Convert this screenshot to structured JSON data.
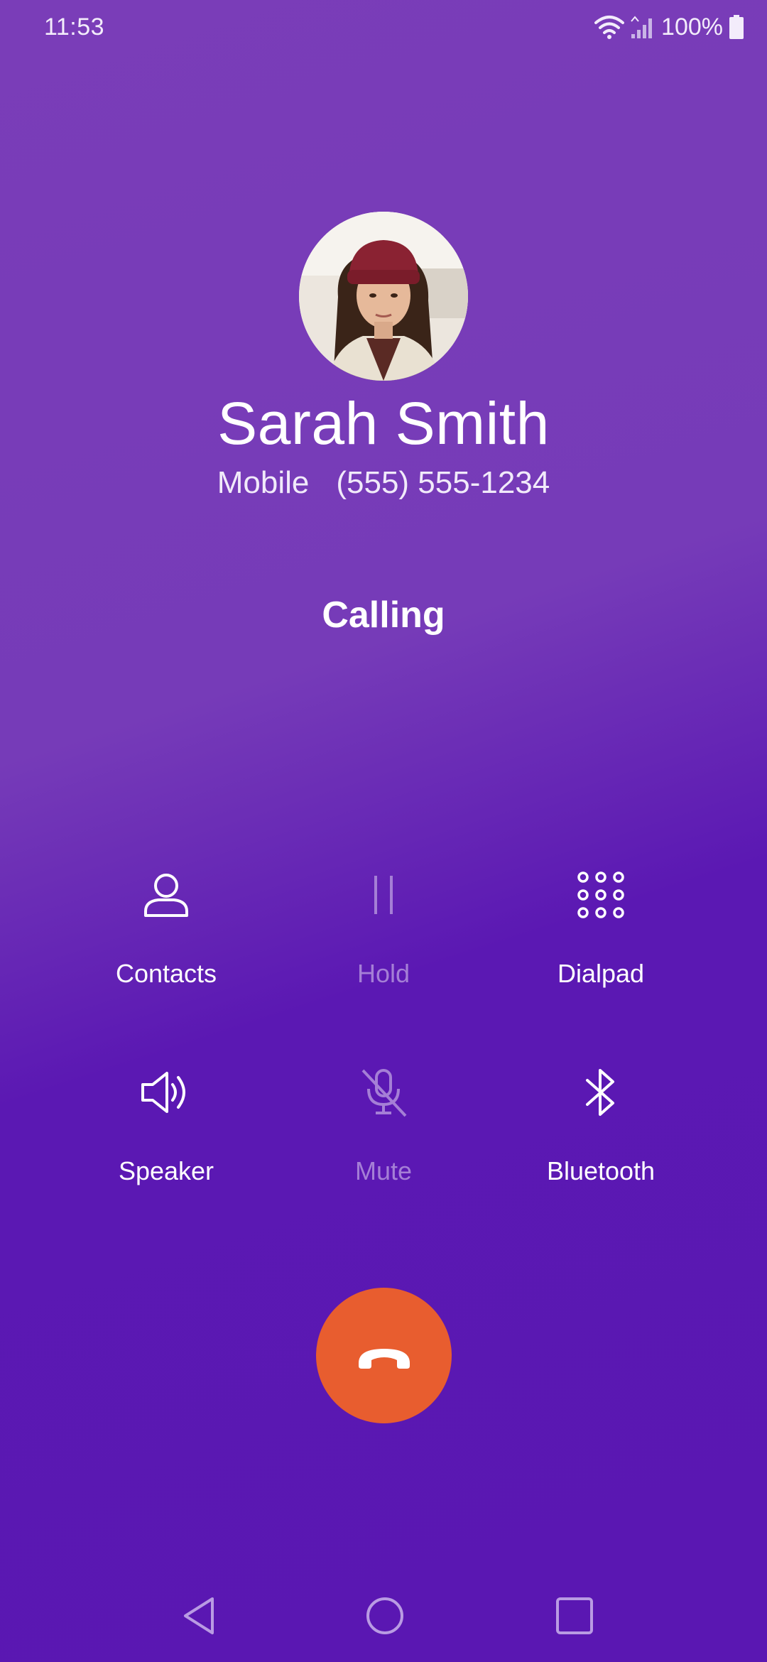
{
  "status_bar": {
    "time": "11:53",
    "battery": "100%",
    "icons": [
      "wifi-icon",
      "signal-icon",
      "battery-icon"
    ]
  },
  "contact": {
    "name": "Sarah Smith",
    "phone_type": "Mobile",
    "phone_number": "(555) 555-1234",
    "avatar_icon": "contact-photo"
  },
  "call": {
    "state": "Calling"
  },
  "controls": [
    {
      "label": "Contacts",
      "icon": "contacts-icon",
      "enabled": true
    },
    {
      "label": "Hold",
      "icon": "hold-icon",
      "enabled": false
    },
    {
      "label": "Dialpad",
      "icon": "dialpad-icon",
      "enabled": true
    },
    {
      "label": "Speaker",
      "icon": "speaker-icon",
      "enabled": true
    },
    {
      "label": "Mute",
      "icon": "mute-icon",
      "enabled": false
    },
    {
      "label": "Bluetooth",
      "icon": "bluetooth-icon",
      "enabled": true
    }
  ],
  "end_call": {
    "icon": "end-call-icon",
    "color": "#e85d2f"
  },
  "navigation": {
    "icons": [
      "back-icon",
      "home-icon",
      "recents-icon"
    ]
  },
  "colors": {
    "background_top": "#7a3db8",
    "background_bottom": "#5a17b2",
    "disabled_label": "#a57fd6",
    "end_call": "#e85d2f"
  }
}
